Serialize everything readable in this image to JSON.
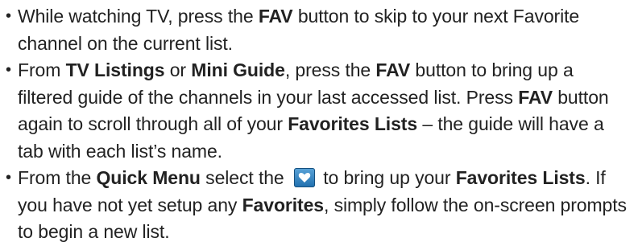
{
  "bullets": [
    {
      "t1": "While watching TV, press the ",
      "b1": "FAV",
      "t2": " button to skip to your next Favorite channel on the current list."
    },
    {
      "t1": "From ",
      "b1": "TV Listings",
      "t2": " or ",
      "b2": "Mini Guide",
      "t3": ", press the ",
      "b3": "FAV",
      "t4": " button to bring up a filtered guide of the channels in your last accessed list.  Press ",
      "b4": "FAV",
      "t5": " button again to scroll through all of your ",
      "b5": "Favorites Lists",
      "t6": " – the guide will have a tab with each list’s name."
    },
    {
      "t1": "From the ",
      "b1": "Quick Menu",
      "t2": " select the ",
      "icon": "heart-icon",
      "t3": " to bring up your ",
      "b2": "Favorites Lists",
      "t4": ".  If you have not yet setup any ",
      "b3": "Favorites",
      "t5": ", simply follow the on-screen prompts to begin a new list."
    }
  ],
  "colors": {
    "text": "#222222",
    "icon_bg": "#2f84c4",
    "icon_heart": "#ffffff"
  }
}
